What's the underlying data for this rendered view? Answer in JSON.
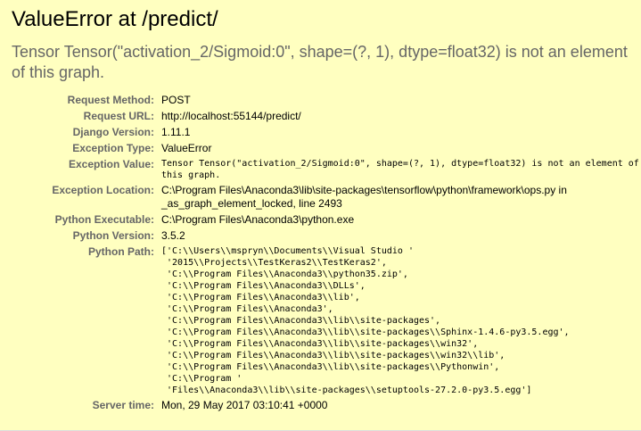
{
  "title": "ValueError at /predict/",
  "exception_value": "Tensor Tensor(\"activation_2/Sigmoid:0\", shape=(?, 1), dtype=float32) is not an element of this graph.",
  "meta": {
    "request_method": {
      "label": "Request Method:",
      "value": "POST"
    },
    "request_url": {
      "label": "Request URL:",
      "value": "http://localhost:55144/predict/"
    },
    "django_version": {
      "label": "Django Version:",
      "value": "1.11.1"
    },
    "exception_type": {
      "label": "Exception Type:",
      "value": "ValueError"
    },
    "exception_value": {
      "label": "Exception Value:",
      "line1": "Tensor Tensor(\"activation_2/Sigmoid:0\", shape=(?, 1), dtype=float32) is not an element of",
      "line2": "this graph."
    },
    "exception_location": {
      "label": "Exception Location:",
      "value": "C:\\Program Files\\Anaconda3\\lib\\site-packages\\tensorflow\\python\\framework\\ops.py in _as_graph_element_locked, line 2493"
    },
    "python_executable": {
      "label": "Python Executable:",
      "value": "C:\\Program Files\\Anaconda3\\python.exe"
    },
    "python_version": {
      "label": "Python Version:",
      "value": "3.5.2"
    },
    "python_path": {
      "label": "Python Path:",
      "lines": [
        "['C:\\\\Users\\\\mspryn\\\\Documents\\\\Visual Studio '",
        " '2015\\\\Projects\\\\TestKeras2\\\\TestKeras2',",
        " 'C:\\\\Program Files\\\\Anaconda3\\\\python35.zip',",
        " 'C:\\\\Program Files\\\\Anaconda3\\\\DLLs',",
        " 'C:\\\\Program Files\\\\Anaconda3\\\\lib',",
        " 'C:\\\\Program Files\\\\Anaconda3',",
        " 'C:\\\\Program Files\\\\Anaconda3\\\\lib\\\\site-packages',",
        " 'C:\\\\Program Files\\\\Anaconda3\\\\lib\\\\site-packages\\\\Sphinx-1.4.6-py3.5.egg',",
        " 'C:\\\\Program Files\\\\Anaconda3\\\\lib\\\\site-packages\\\\win32',",
        " 'C:\\\\Program Files\\\\Anaconda3\\\\lib\\\\site-packages\\\\win32\\\\lib',",
        " 'C:\\\\Program Files\\\\Anaconda3\\\\lib\\\\site-packages\\\\Pythonwin',",
        " 'C:\\\\Program '",
        " 'Files\\\\Anaconda3\\\\lib\\\\site-packages\\\\setuptools-27.2.0-py3.5.egg']"
      ]
    },
    "server_time": {
      "label": "Server time:",
      "value": "Mon, 29 May 2017 03:10:41 +0000"
    }
  }
}
